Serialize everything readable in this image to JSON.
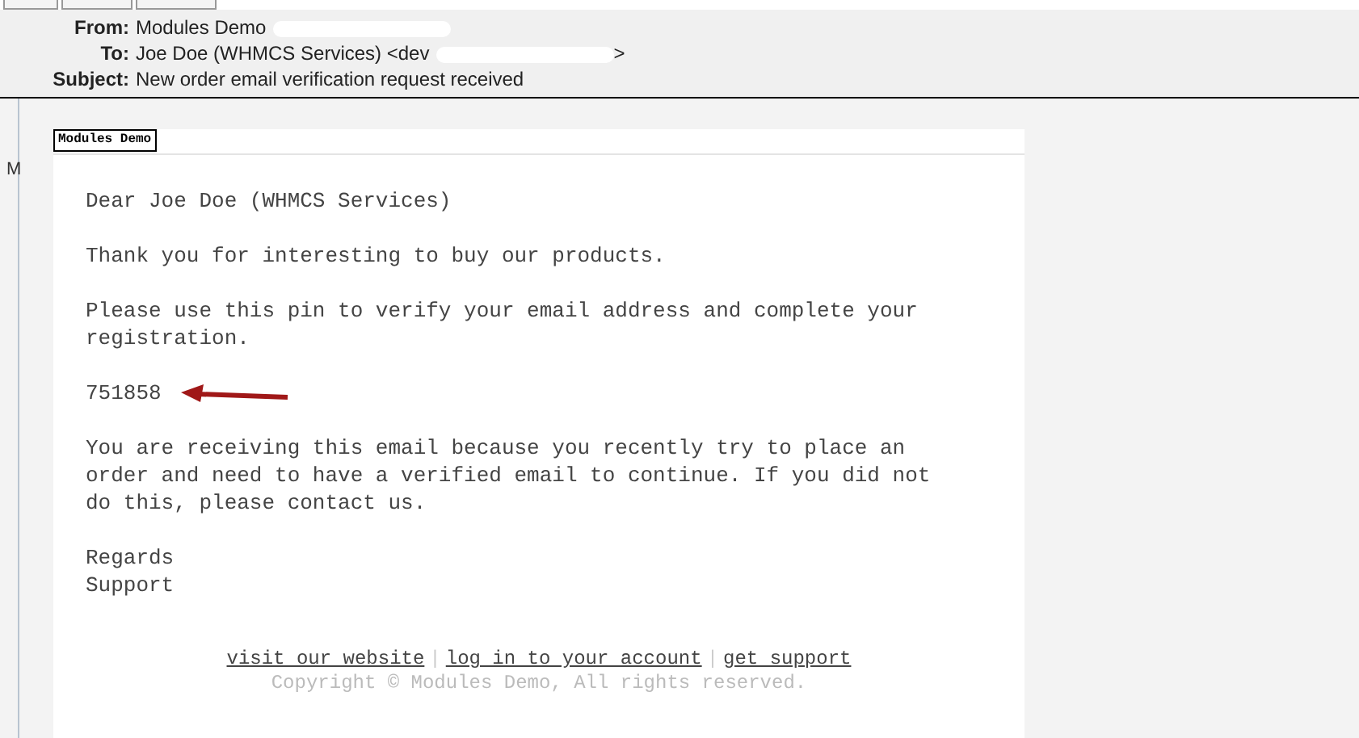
{
  "header": [
    {
      "label": "From:",
      "value": "Modules Demo",
      "redacted": true
    },
    {
      "label": "To:",
      "value": "Joe Doe (WHMCS Services) <dev",
      "redacted": true,
      "redacted_suffix": ">"
    },
    {
      "label": "Subject:",
      "value": "New order email verification request received",
      "redacted": false
    }
  ],
  "sidebar_letter": "M",
  "email": {
    "logo": "Modules Demo",
    "paragraphs": [
      {
        "kind": "text",
        "text": "Dear Joe Doe (WHMCS Services)"
      },
      {
        "kind": "text",
        "text": "Thank you for interesting to buy our products."
      },
      {
        "kind": "text",
        "text": "Please use this pin to verify your email address and complete your registration."
      },
      {
        "kind": "pin",
        "text": "751858"
      },
      {
        "kind": "text",
        "text": "You are receiving this email because you recently try to place an order and need to have a verified email to continue. If you did not do this, please contact us."
      },
      {
        "kind": "lines",
        "lines": [
          "Regards",
          "Support"
        ]
      }
    ],
    "links": [
      "visit our website",
      "log in to your account",
      "get support"
    ],
    "link_separator": "|",
    "copyright": "Copyright © Modules Demo, All rights reserved."
  }
}
